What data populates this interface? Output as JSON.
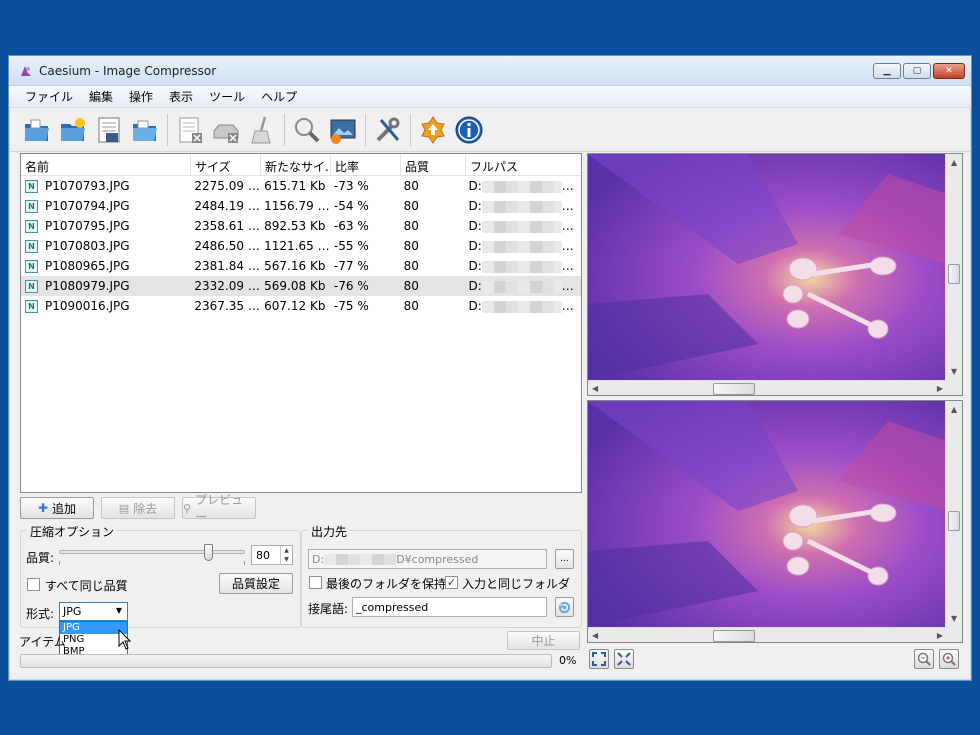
{
  "window": {
    "title": "Caesium - Image Compressor"
  },
  "menu": [
    "ファイル",
    "編集",
    "操作",
    "表示",
    "ツール",
    "ヘルプ"
  ],
  "toolbar_icons": [
    "open-folder-icon",
    "new-folder-icon",
    "save-icon",
    "folder-icon",
    "clear-list-icon",
    "remove-drive-icon",
    "broom-icon",
    "preview-icon",
    "image-settings-icon",
    "tools-icon",
    "update-icon",
    "info-icon"
  ],
  "list": {
    "headers": [
      "名前",
      "サイズ",
      "新たなサイ.",
      "比率",
      "品質",
      "フルパス"
    ],
    "rows": [
      {
        "name": "P1070793.JPG",
        "size": "2275.09 …",
        "new_size": "615.71 Kb",
        "ratio": "-73 %",
        "quality": "80",
        "path": "D:"
      },
      {
        "name": "P1070794.JPG",
        "size": "2484.19 …",
        "new_size": "1156.79 …",
        "ratio": "-54 %",
        "quality": "80",
        "path": "D:"
      },
      {
        "name": "P1070795.JPG",
        "size": "2358.61 …",
        "new_size": "892.53 Kb",
        "ratio": "-63 %",
        "quality": "80",
        "path": "D:"
      },
      {
        "name": "P1070803.JPG",
        "size": "2486.50 …",
        "new_size": "1121.65 …",
        "ratio": "-55 %",
        "quality": "80",
        "path": "D:"
      },
      {
        "name": "P1080965.JPG",
        "size": "2381.84 …",
        "new_size": "567.16 Kb",
        "ratio": "-77 %",
        "quality": "80",
        "path": "D:"
      },
      {
        "name": "P1080979.JPG",
        "size": "2332.09 …",
        "new_size": "569.08 Kb",
        "ratio": "-76 %",
        "quality": "80",
        "path": "D:"
      },
      {
        "name": "P1090016.JPG",
        "size": "2367.35 …",
        "new_size": "607.12 Kb",
        "ratio": "-75 %",
        "quality": "80",
        "path": "D:"
      }
    ],
    "file_badge": "N"
  },
  "buttons": {
    "add": "追加",
    "remove": "除去",
    "preview": "プレビュー",
    "quality_settings": "品質設定",
    "stop": "中止"
  },
  "compression": {
    "title": "圧縮オプション",
    "quality_label": "品質:",
    "quality_value": "80",
    "quality_level": 0.8,
    "same_quality_label": "すべて同じ品質",
    "format_label": "形式:",
    "format_selected": "JPG",
    "format_options": [
      "JPG",
      "PNG",
      "BMP"
    ]
  },
  "output": {
    "title": "出力先",
    "path_start": "D:",
    "path_end": "D¥compressed",
    "browse": "...",
    "keep_last_folder": "最後のフォルダを保持",
    "same_as_input": "入力と同じフォルダ",
    "suffix_label": "接尾語:",
    "suffix_value": "_compressed"
  },
  "status": {
    "items_label": "アイテム",
    "progress_text": "0%",
    "progress_level": 0
  },
  "colors": {
    "desktop": "#0a4f9b",
    "petal": "#7a3cc4",
    "center": "#c23c9a"
  }
}
